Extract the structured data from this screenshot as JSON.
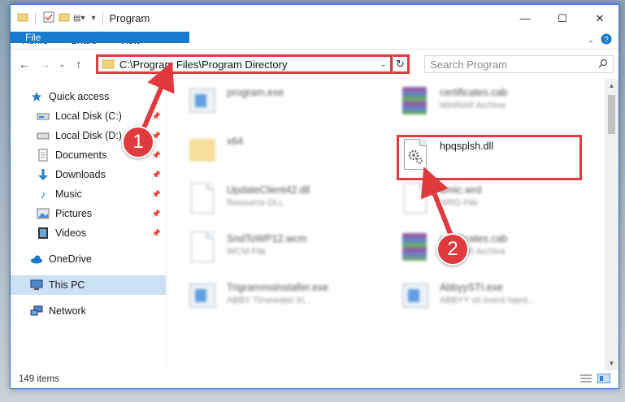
{
  "window": {
    "title": "Program"
  },
  "ribbon": {
    "tabs": [
      "File",
      "Home",
      "Share",
      "View"
    ]
  },
  "address": {
    "path": "C:\\Program Files\\Program Directory"
  },
  "search": {
    "placeholder": "Search Program"
  },
  "nav": {
    "items": [
      {
        "label": "Quick access",
        "icon": "star-icon"
      },
      {
        "label": "Local Disk (C:)",
        "icon": "drive-icon",
        "pinned": true
      },
      {
        "label": "Local Disk (D:)",
        "icon": "drive-icon",
        "pinned": true
      },
      {
        "label": "Documents",
        "icon": "documents-icon",
        "pinned": true
      },
      {
        "label": "Downloads",
        "icon": "download-icon",
        "pinned": true
      },
      {
        "label": "Music",
        "icon": "music-icon",
        "pinned": true
      },
      {
        "label": "Pictures",
        "icon": "pictures-icon",
        "pinned": true
      },
      {
        "label": "Videos",
        "icon": "videos-icon",
        "pinned": true
      },
      {
        "label": "OneDrive",
        "icon": "cloud-icon"
      },
      {
        "label": "This PC",
        "icon": "computer-icon",
        "selected": true
      },
      {
        "label": "Network",
        "icon": "network-icon"
      }
    ]
  },
  "files": {
    "left": [
      {
        "name": "program.exe",
        "type": "",
        "icon": "exe-icon"
      },
      {
        "name": "x64",
        "type": "",
        "icon": "folder-icon"
      },
      {
        "name": "UpdateClient42.dll",
        "type": "Resource DLL",
        "icon": "dll-icon"
      },
      {
        "name": "SndToWP12.wcm",
        "type": "WCM File",
        "icon": "file-icon"
      },
      {
        "name": "Trigrammsinstaller.exe",
        "type": "ABBY Timewater tri...",
        "icon": "exe-icon"
      }
    ],
    "right": [
      {
        "name": "certificates.cab",
        "type": "WinRAR Archive",
        "icon": "rar-icon"
      },
      {
        "name": "hpqsplsh.dll",
        "type": "",
        "icon": "gear-file-icon"
      },
      {
        "name": "Bmic.wrd",
        "type": "WRD File",
        "icon": "file-icon"
      },
      {
        "name": "certificates.cab",
        "type": "WinRAR Archive",
        "icon": "rar-icon"
      },
      {
        "name": "AbbyySTI.exe",
        "type": "ABBYY sti event hand...",
        "icon": "exe-icon"
      }
    ]
  },
  "status": {
    "count": "149 items"
  },
  "callouts": [
    "1",
    "2"
  ],
  "colors": {
    "accent": "#1979ca",
    "highlight": "#e0393e"
  }
}
